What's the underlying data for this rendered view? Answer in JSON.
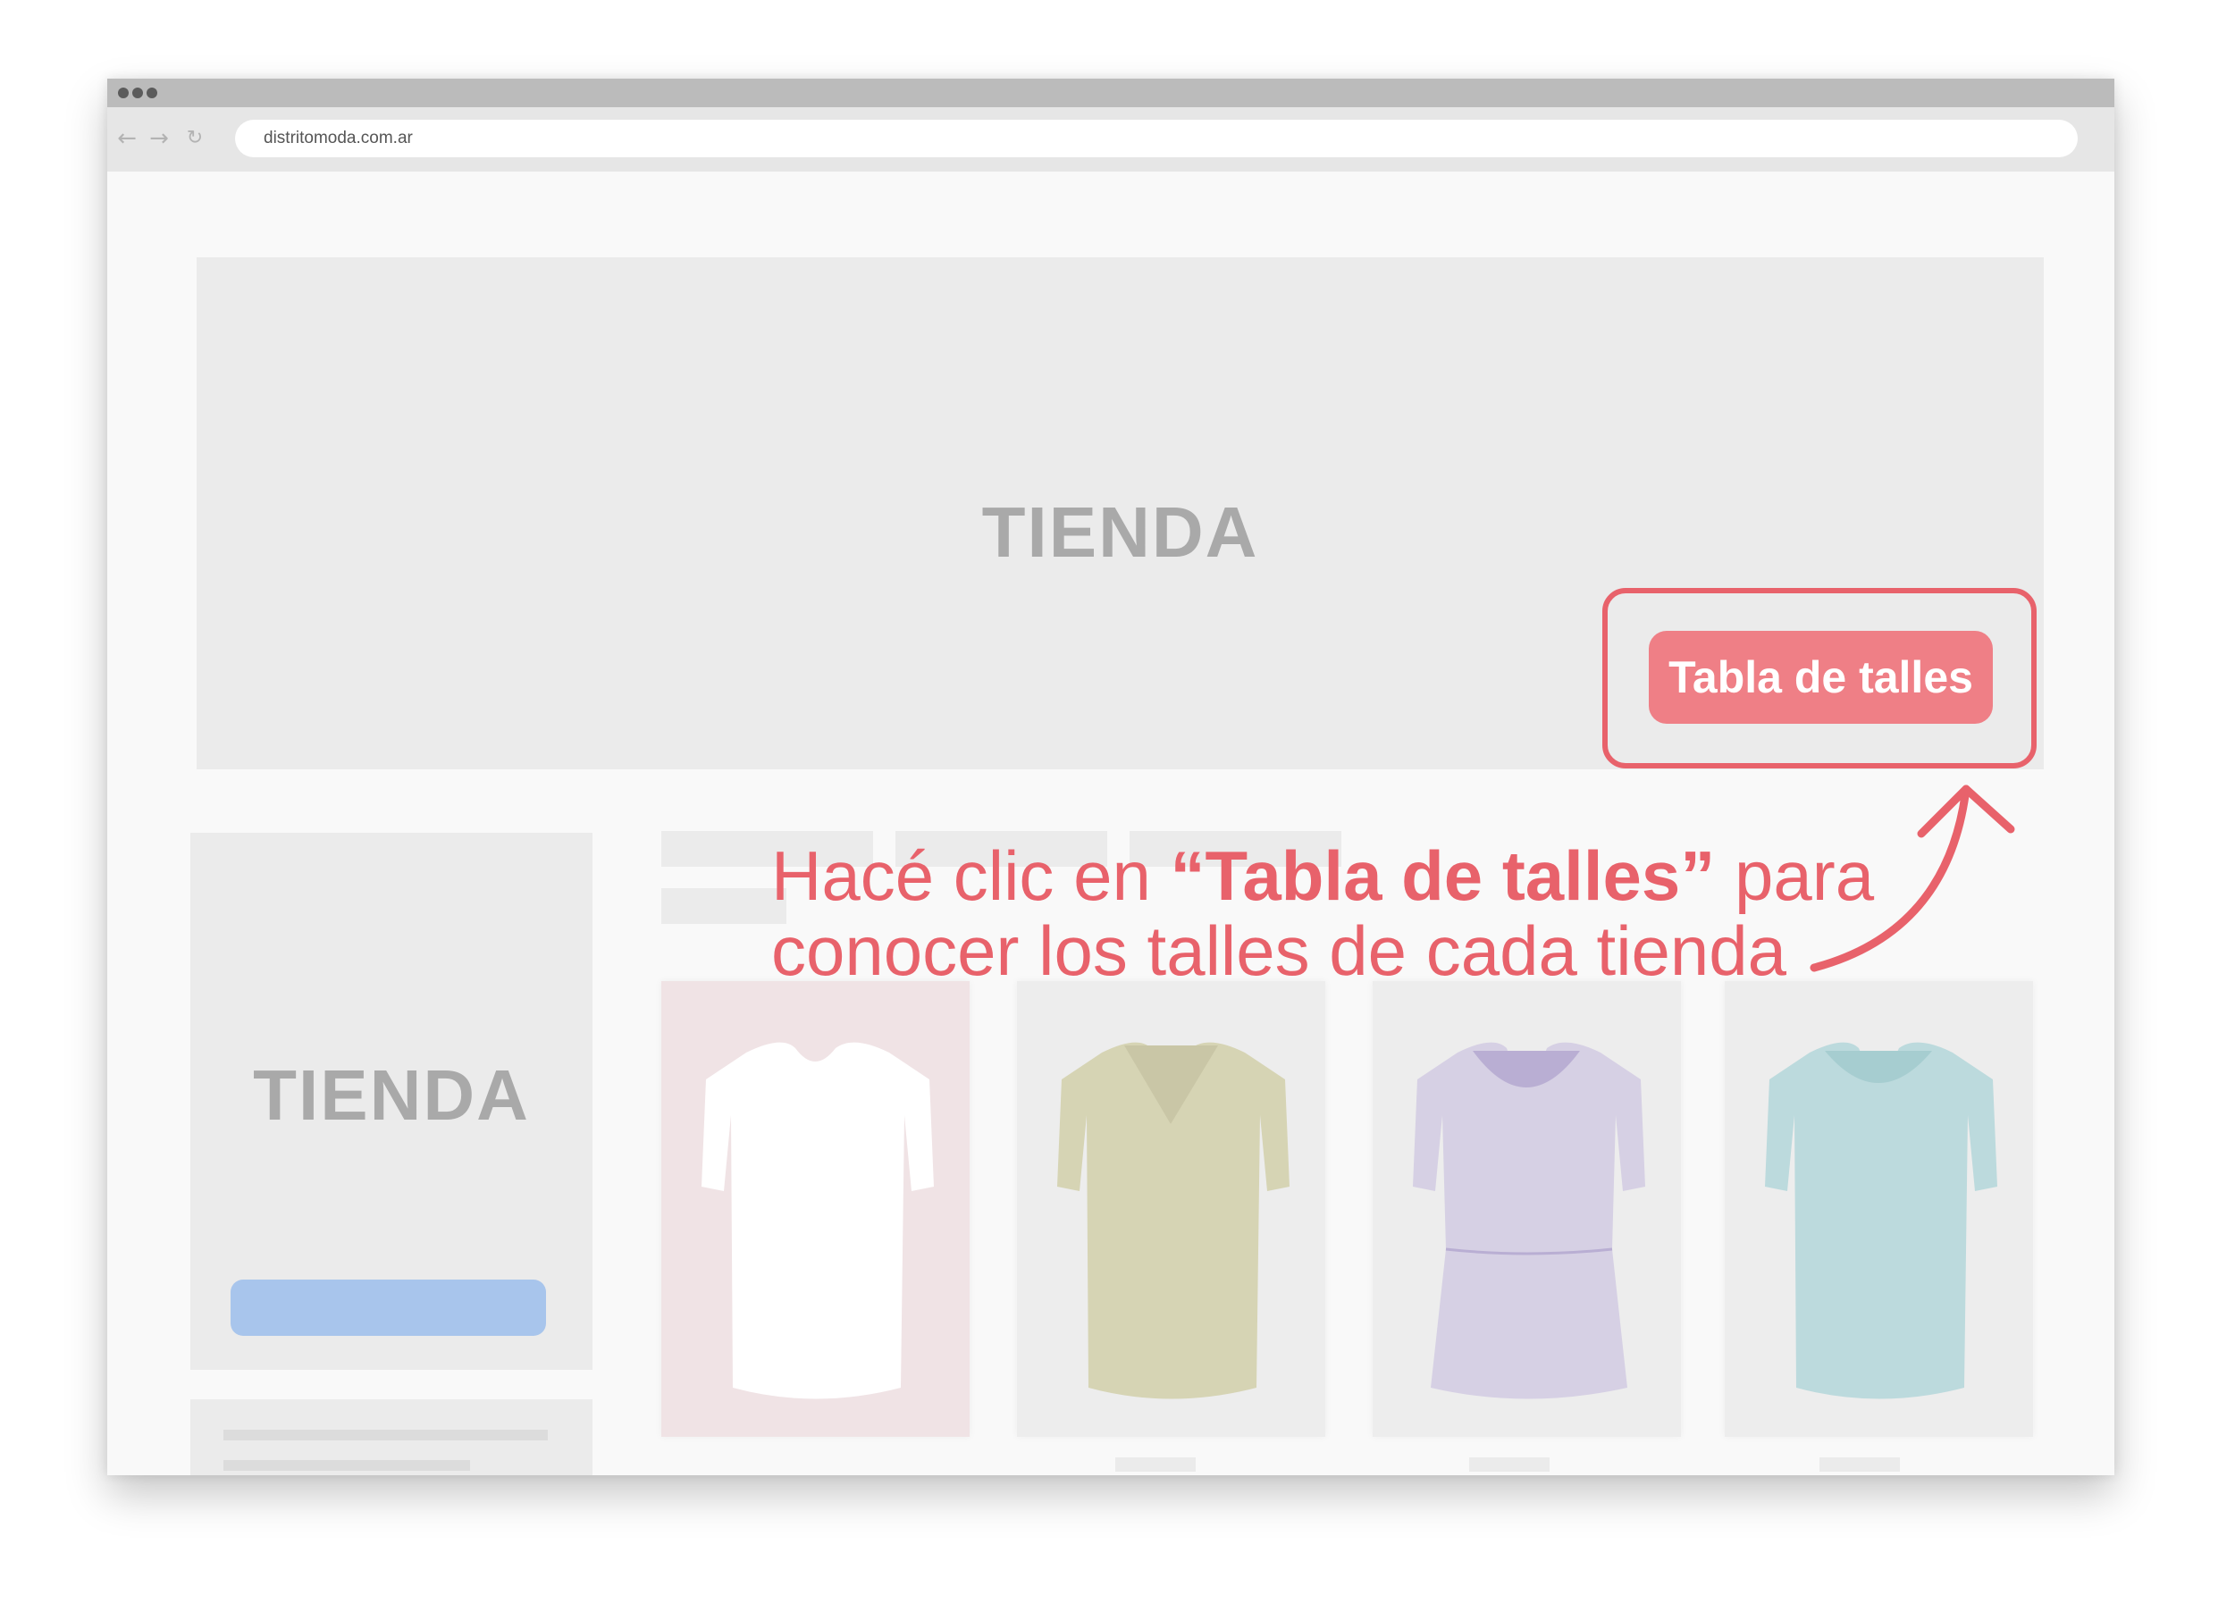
{
  "browser": {
    "url": "distritomoda.com.ar"
  },
  "hero": {
    "title": "TIENDA",
    "size_chart_button": "Tabla de talles"
  },
  "side_card": {
    "title": "TIENDA"
  },
  "callout": {
    "prefix": "Hacé clic en ",
    "emphasis": "“Tabla de talles”",
    "suffix": " para conocer los talles de cada tienda"
  },
  "products": [
    {
      "name": "white-shirt",
      "color": "#ffffff",
      "card_bg": "#f0e3e5"
    },
    {
      "name": "olive-shirt",
      "color": "#d6d4b4",
      "card_bg": "#ededed"
    },
    {
      "name": "lilac-shirt",
      "color": "#d6d0e4",
      "card_bg": "#ededed"
    },
    {
      "name": "aqua-shirt",
      "color": "#bcdadd",
      "card_bg": "#ededed"
    }
  ],
  "colors": {
    "accent": "#e8626b",
    "button": "#ef7f86",
    "placeholder_button": "#a8c5ec"
  }
}
